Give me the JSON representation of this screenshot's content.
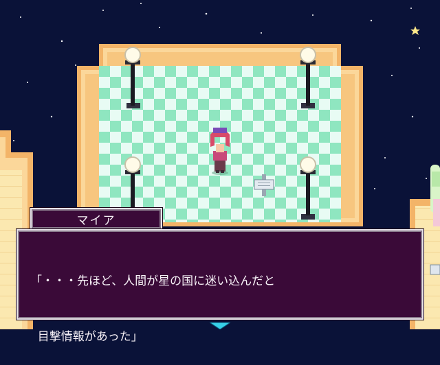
{
  "dialogue": {
    "speaker": "マイア",
    "lines": [
      "「・・・先ほど、人間が星の国に迷い込んだと",
      "  目撃情報があった」"
    ]
  },
  "colors": {
    "space": "#0a1238",
    "floor_tile_light": "#e8fbf4",
    "floor_tile_green": "#8fe6c0",
    "wall_frame": "#f3b468",
    "dialog_bg": "#3a0a38",
    "dialog_border": "#e9e4ea"
  },
  "icons": [
    "lamp-post-icon",
    "signpost-icon",
    "player-character",
    "continue-cursor-icon"
  ]
}
